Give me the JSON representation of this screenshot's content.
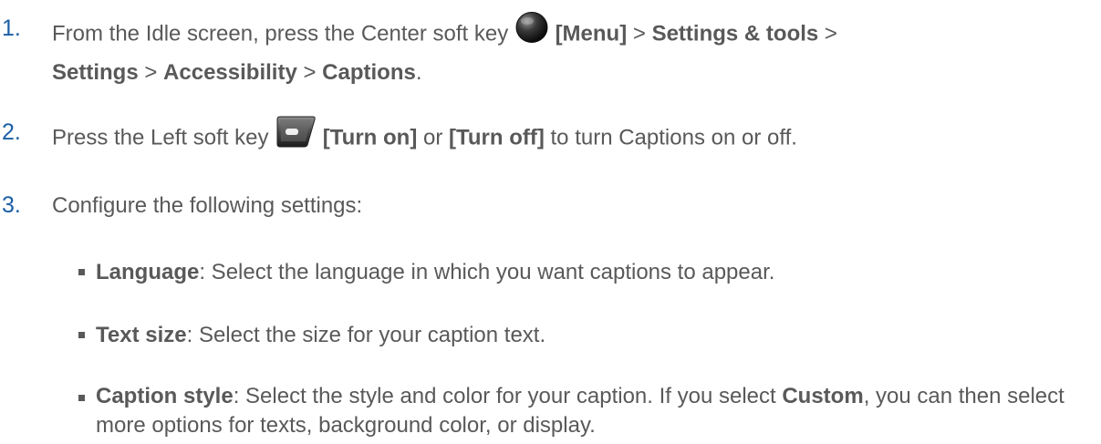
{
  "steps": [
    {
      "number": "1.",
      "parts": {
        "a": "From the Idle screen, press the Center soft key ",
        "icon": "center-soft-key-icon",
        "b": "[Menu]",
        "c": " > ",
        "d": "Settings & tools",
        "e": " > ",
        "f": "Settings",
        "g": " > ",
        "h": "Accessibility",
        "i": " > ",
        "j": "Captions",
        "k": "."
      }
    },
    {
      "number": "2.",
      "parts": {
        "a": "Press the Left soft key ",
        "icon": "left-soft-key-icon",
        "b": "[Turn on]",
        "c": " or ",
        "d": "[Turn off]",
        "e": " to turn Captions on or off."
      }
    },
    {
      "number": "3.",
      "parts": {
        "a": "Configure the following settings:"
      }
    }
  ],
  "bullets": [
    {
      "term": "Language",
      "text": ": Select the language in which you want captions to appear."
    },
    {
      "term": "Text size",
      "text": ": Select the size for your caption text."
    },
    {
      "term": "Caption style",
      "text_a": ": Select the style and color for your caption. If you select ",
      "term_b": "Custom",
      "text_b": ", you can then select more options for texts, background color, or display."
    }
  ]
}
